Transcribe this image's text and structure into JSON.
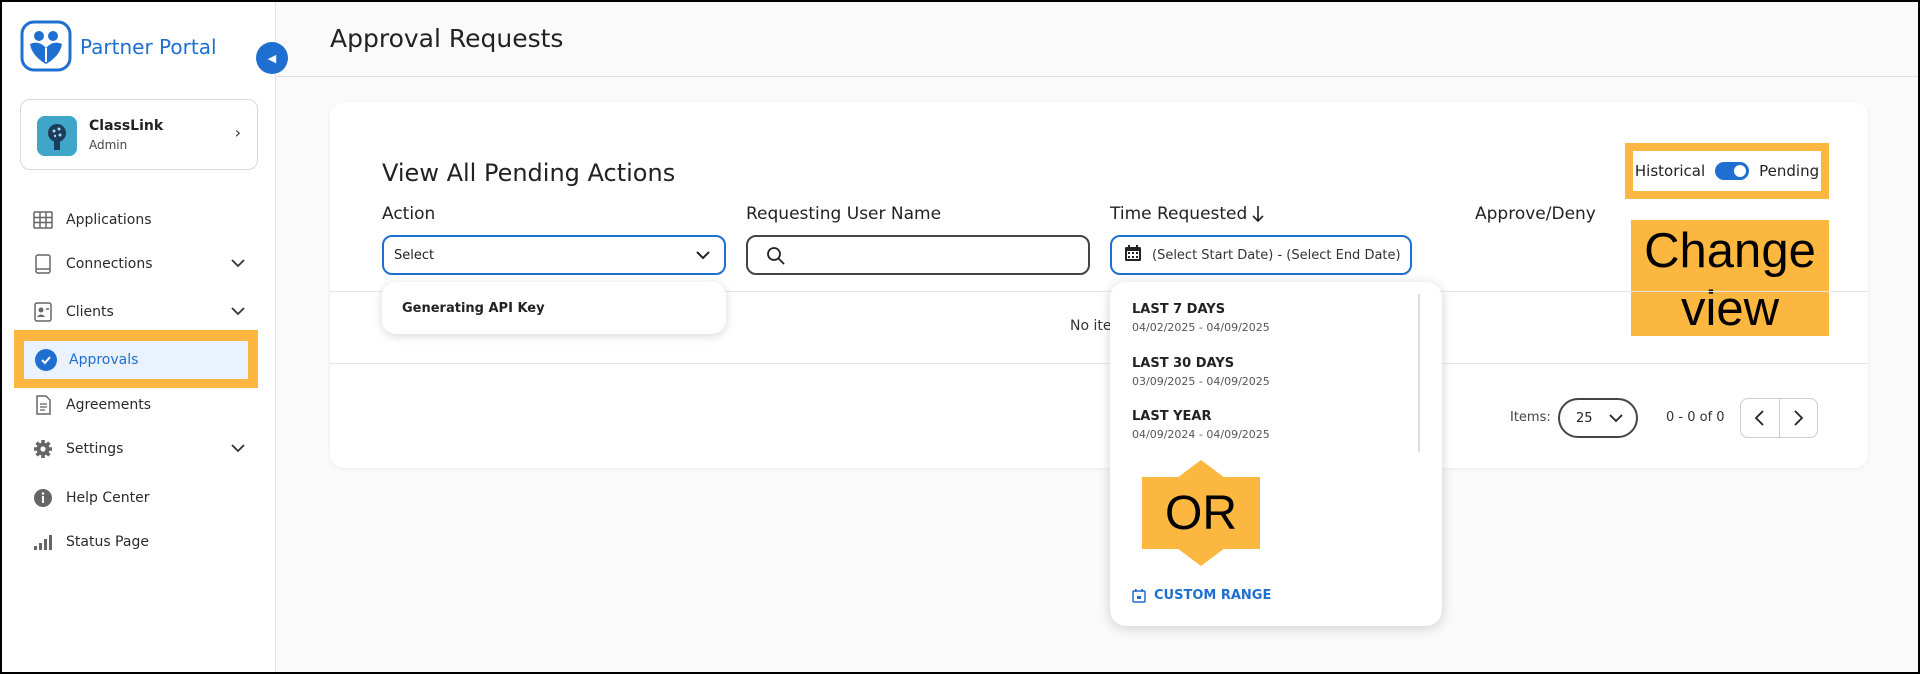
{
  "brand": {
    "name": "Partner Portal"
  },
  "org": {
    "name": "ClassLink",
    "role": "Admin"
  },
  "nav": {
    "applications": "Applications",
    "connections": "Connections",
    "clients": "Clients",
    "approvals": "Approvals",
    "agreements": "Agreements",
    "settings": "Settings",
    "help_center": "Help Center",
    "status_page": "Status Page"
  },
  "header": {
    "title": "Approval Requests"
  },
  "main": {
    "card_title": "View All Pending Actions",
    "view_toggle": {
      "left_label": "Historical",
      "right_label": "Pending",
      "on": true
    },
    "columns": {
      "action": "Action",
      "requesting_user": "Requesting User Name",
      "time_requested": "Time Requested",
      "approve_deny": "Approve/Deny"
    },
    "action_filter": {
      "value": "Select",
      "options": [
        "Generating API Key"
      ]
    },
    "date_filter": {
      "value": "(Select Start Date) - (Select End Date)"
    },
    "date_options": [
      {
        "label": "LAST 7 DAYS",
        "range": "04/02/2025 - 04/09/2025"
      },
      {
        "label": "LAST 30 DAYS",
        "range": "03/09/2025 - 04/09/2025"
      },
      {
        "label": "LAST YEAR",
        "range": "04/09/2024 - 04/09/2025"
      }
    ],
    "custom_range": "CUSTOM RANGE",
    "empty_text": "No iter",
    "pagination": {
      "items_label": "Items:",
      "page_size": "25",
      "range": "0 - 0 of 0"
    }
  },
  "annotations": {
    "change_view": "Change view",
    "or": "OR"
  },
  "colors": {
    "accent": "#1f6fd1",
    "highlight": "#fbb73f"
  },
  "icons": [
    "logo-icon",
    "collapse-icon",
    "grid-icon",
    "tablet-icon",
    "clients-icon",
    "check-circle-icon",
    "document-icon",
    "gear-icon",
    "info-icon",
    "signal-icon",
    "chevron-down-icon",
    "search-icon",
    "calendar-icon",
    "arrow-down-icon",
    "chevron-left-icon",
    "chevron-right-icon"
  ]
}
